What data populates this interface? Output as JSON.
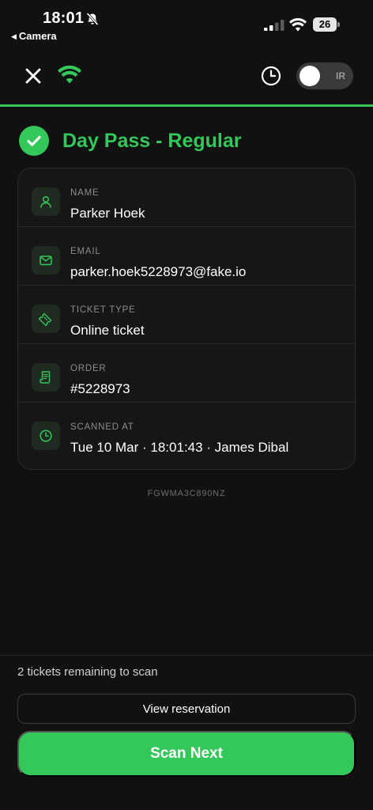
{
  "status_bar": {
    "time": "18:01",
    "back_label": "Camera",
    "battery": "26"
  },
  "toolbar": {
    "ir_label": "IR"
  },
  "pass": {
    "title": "Day Pass - Regular"
  },
  "details": [
    {
      "label": "NAME",
      "value": "Parker Hoek",
      "icon": "person-icon"
    },
    {
      "label": "EMAIL",
      "value": "parker.hoek5228973@fake.io",
      "icon": "mail-icon"
    },
    {
      "label": "TICKET TYPE",
      "value": "Online ticket",
      "icon": "ticket-icon"
    },
    {
      "label": "ORDER",
      "value": "#5228973",
      "icon": "receipt-icon"
    },
    {
      "label": "SCANNED AT",
      "value": "Tue 10 Mar · 18:01:43 · James Dibal",
      "icon": "clock-icon"
    }
  ],
  "ticket_code": "FGWMA3C890NZ",
  "footer": {
    "remaining_text": "2 tickets remaining to scan",
    "view_reservation_label": "View reservation",
    "scan_next_label": "Scan Next"
  },
  "colors": {
    "accent": "#34c759",
    "background": "#111111",
    "card": "#161616"
  }
}
